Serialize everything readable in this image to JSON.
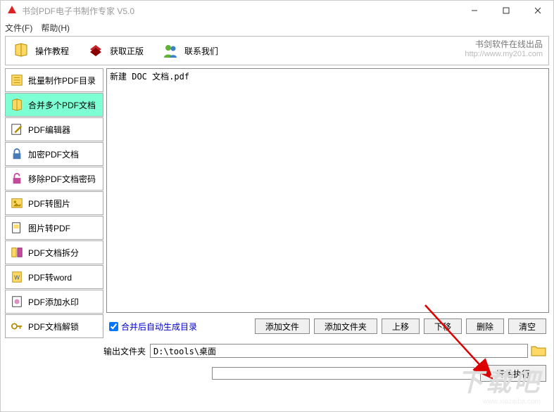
{
  "window": {
    "title": "书剑PDF电子书制作专家 V5.0"
  },
  "menu": {
    "file": "文件(F)",
    "help": "帮助(H)"
  },
  "toolbar": {
    "tutorial": "操作教程",
    "legit": "获取正版",
    "contact": "联系我们",
    "brand": "书剑软件在线出品",
    "brand_url": "http://www.my201.com"
  },
  "sidebar": {
    "items": [
      {
        "label": "批量制作PDF目录",
        "icon": "list-icon"
      },
      {
        "label": "合并多个PDF文档",
        "icon": "merge-icon"
      },
      {
        "label": "PDF编辑器",
        "icon": "edit-icon"
      },
      {
        "label": "加密PDF文档",
        "icon": "lock-icon"
      },
      {
        "label": "移除PDF文档密码",
        "icon": "unlock-icon"
      },
      {
        "label": "PDF转图片",
        "icon": "image-icon"
      },
      {
        "label": "图片转PDF",
        "icon": "imagepdf-icon"
      },
      {
        "label": "PDF文档拆分",
        "icon": "split-icon"
      },
      {
        "label": "PDF转word",
        "icon": "word-icon"
      },
      {
        "label": "PDF添加水印",
        "icon": "watermark-icon"
      },
      {
        "label": "PDF文档解锁",
        "icon": "key-icon"
      }
    ],
    "active_index": 1
  },
  "files": {
    "items": [
      "新建 DOC 文档.pdf"
    ]
  },
  "controls": {
    "checkbox_label": "合并后自动生成目录",
    "checkbox_checked": true,
    "add_file": "添加文件",
    "add_folder": "添加文件夹",
    "move_up": "上移",
    "move_down": "下移",
    "delete": "删除",
    "clear": "清空"
  },
  "output": {
    "label": "输出文件夹",
    "value": "D:\\tools\\桌面"
  },
  "action": {
    "execute": "开始执行"
  },
  "watermark": {
    "text": "下载吧",
    "url": "www.xiazaiba.com"
  }
}
